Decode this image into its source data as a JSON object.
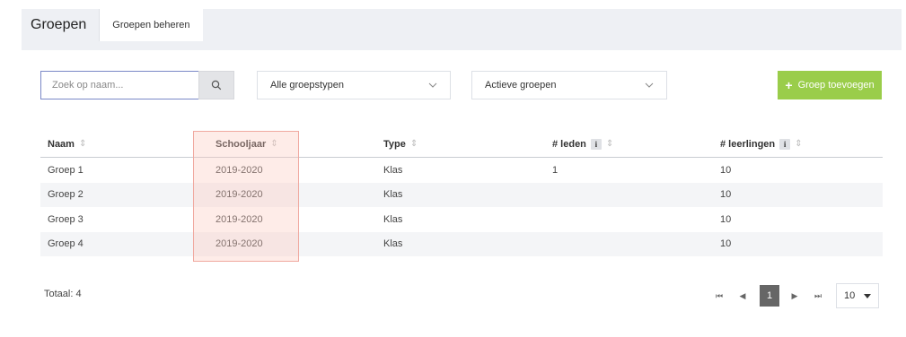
{
  "tabs": {
    "main": "Groepen",
    "sub": "Groepen beheren"
  },
  "toolbar": {
    "search_placeholder": "Zoek op naam...",
    "type_filter": "Alle groepstypen",
    "status_filter": "Actieve groepen",
    "add_label": "Groep toevoegen"
  },
  "table": {
    "headers": {
      "name": "Naam",
      "year": "Schooljaar",
      "type": "Type",
      "members": "# leden",
      "students": "# leerlingen"
    },
    "rows": [
      {
        "name": "Groep 1",
        "year": "2019-2020",
        "type": "Klas",
        "members": "1",
        "students": "10"
      },
      {
        "name": "Groep 2",
        "year": "2019-2020",
        "type": "Klas",
        "members": "",
        "students": "10"
      },
      {
        "name": "Groep 3",
        "year": "2019-2020",
        "type": "Klas",
        "members": "",
        "students": "10"
      },
      {
        "name": "Groep 4",
        "year": "2019-2020",
        "type": "Klas",
        "members": "",
        "students": "10"
      }
    ]
  },
  "footer": {
    "total": "Totaal: 4",
    "current_page": "1",
    "page_size": "10"
  },
  "colors": {
    "accent": "#9acd4a",
    "highlight_border": "#f0a9a0",
    "search_border": "#7a88c7"
  },
  "icons": {
    "search": "search-icon",
    "sort": "sort-icon",
    "info": "info-icon",
    "add": "plus-icon"
  }
}
